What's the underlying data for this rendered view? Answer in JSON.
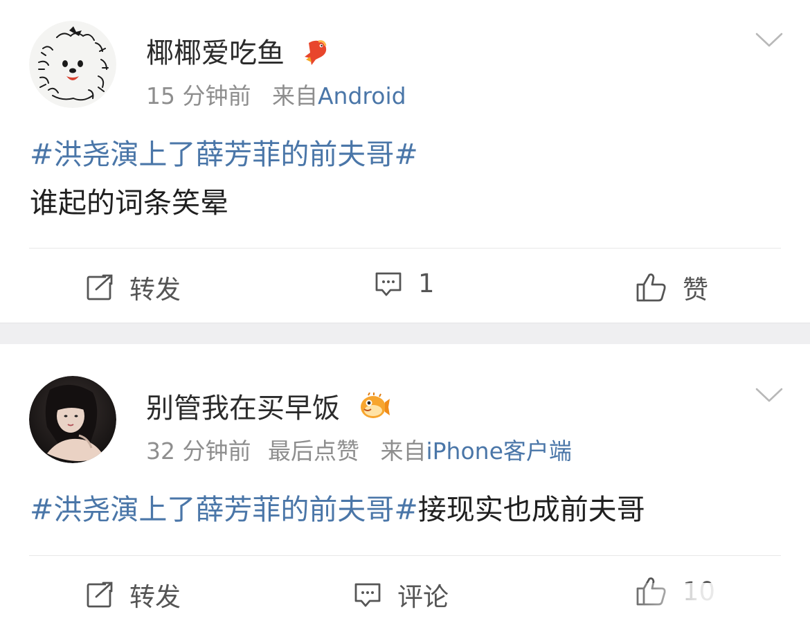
{
  "posts": [
    {
      "username": "椰椰爱吃鱼",
      "badge_icon": "goldfish-badge-icon",
      "time": "15 分钟前",
      "source_prefix": "来自",
      "source": "Android",
      "hashtag": "#洪尧演上了薛芳菲的前夫哥#",
      "text": "谁起的词条笑晕",
      "actions": {
        "repost": "转发",
        "comment": "1",
        "like": "赞"
      }
    },
    {
      "username": "别管我在买早饭",
      "badge_icon": "pufferfish-badge-icon",
      "time": "32 分钟前",
      "extra": "最后点赞",
      "source_prefix": "来自",
      "source": "iPhone客户端",
      "hashtag": "#洪尧演上了薛芳菲的前夫哥#",
      "text": "接现实也成前夫哥",
      "actions": {
        "repost": "转发",
        "comment": "评论",
        "like": "10"
      }
    }
  ],
  "colors": {
    "link": "#4a76a8",
    "meta": "#8e8e8e",
    "separator": "#efeff1"
  }
}
